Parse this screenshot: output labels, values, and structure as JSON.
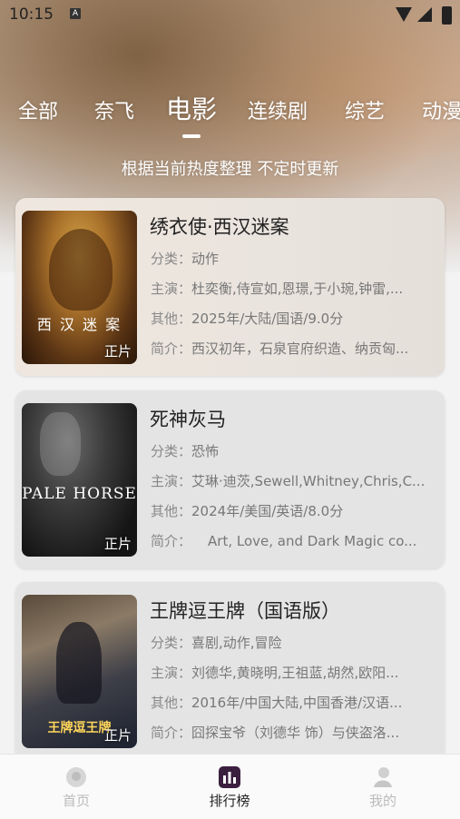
{
  "status_bar": {
    "time": "10:15",
    "notif_glyph": "A"
  },
  "tabs": [
    "全部",
    "奈飞",
    "电影",
    "连续剧",
    "综艺",
    "动漫"
  ],
  "active_tab_index": 2,
  "subtitle": "根据当前热度整理 不定时更新",
  "cards": [
    {
      "title": "绣衣使·西汉迷案",
      "category_label": "分类：",
      "category": "动作",
      "cast_label": "主演：",
      "cast": "杜奕衡,侍宣如,恩璟,于小琬,钟雷,...",
      "other_label": "其他：",
      "other": "2025年/大陆/国语/9.0分",
      "intro_label": "简介：",
      "intro": "西汉初年，石泉官府织造、纳贡匈...",
      "badge": "正片",
      "poster_text": "西 汉 迷 案"
    },
    {
      "title": "死神灰马",
      "category_label": "分类：",
      "category": "恐怖",
      "cast_label": "主演：",
      "cast": "艾琳·迪茨,Sewell,Whitney,Chris,C...",
      "other_label": "其他：",
      "other": "2024年/美国/英语/8.0分",
      "intro_label": "简介：",
      "intro": "Art, Love, and Dark Magic co...",
      "badge": "正片",
      "poster_text": "PALE HORSE"
    },
    {
      "title": "王牌逗王牌（国语版）",
      "category_label": "分类：",
      "category": "喜剧,动作,冒险",
      "cast_label": "主演：",
      "cast": "刘德华,黄晓明,王祖蓝,胡然,欧阳...",
      "other_label": "其他：",
      "other": "2016年/中国大陆,中国香港/汉语...",
      "intro_label": "简介：",
      "intro": "囧探宝爷（刘德华 饰）与侠盗洛...",
      "badge": "正片",
      "poster_text": "王牌逗王牌"
    }
  ],
  "bottom_nav": [
    {
      "label": "首页",
      "icon": "home-icon"
    },
    {
      "label": "排行榜",
      "icon": "ranking-icon"
    },
    {
      "label": "我的",
      "icon": "profile-icon"
    }
  ],
  "colors": {
    "accent": "#222222",
    "inactive": "#bbbbbb",
    "tab_text": "#ffffff"
  }
}
